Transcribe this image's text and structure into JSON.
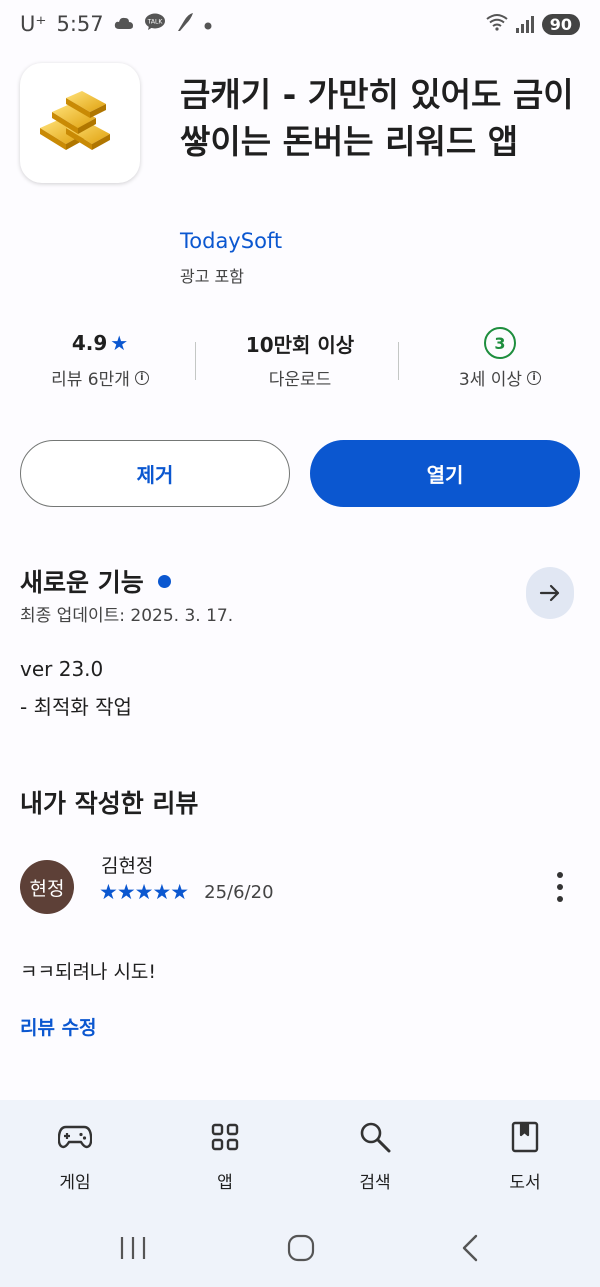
{
  "status_bar": {
    "carrier": "U⁺",
    "time": "5:57",
    "notification_icons": [
      "cloud-icon",
      "talk-icon",
      "quill-icon",
      "dot-icon"
    ],
    "talk_label": "TALK",
    "battery": "90"
  },
  "app": {
    "title": "금캐기 - 가만히 있어도 금이 쌓이는 돈버는 리워드 앱",
    "developer": "TodaySoft",
    "ad_note": "광고 포함",
    "icon": "gold-bars-icon"
  },
  "stats": {
    "rating_value": "4.9",
    "rating_star": "★",
    "reviews_label": "리뷰 6만개",
    "downloads_value": "10만회 이상",
    "downloads_label": "다운로드",
    "age_badge": "3",
    "age_label": "3세 이상"
  },
  "buttons": {
    "remove_label": "제거",
    "open_label": "열기"
  },
  "whats_new": {
    "title": "새로운 기능",
    "updated": "최종 업데이트: 2025. 3. 17.",
    "notes": [
      "ver 23.0",
      "- 최적화 작업"
    ]
  },
  "my_review": {
    "title": "내가 작성한 리뷰",
    "avatar_text": "현정",
    "reviewer": "김현정",
    "stars": "★★★★★",
    "rating": 5,
    "date": "25/6/20",
    "text": "ㅋㅋ되려나 시도!",
    "edit_label": "리뷰 수정"
  },
  "bottom_nav": {
    "items": [
      {
        "label": "게임",
        "icon": "gamepad-icon"
      },
      {
        "label": "앱",
        "icon": "apps-grid-icon"
      },
      {
        "label": "검색",
        "icon": "search-icon"
      },
      {
        "label": "도서",
        "icon": "book-icon"
      }
    ]
  },
  "colors": {
    "accent": "#0b57d0",
    "age_green": "#1e8e3e",
    "avatar_bg": "#5d4037",
    "nav_bg": "#eff3fa"
  }
}
